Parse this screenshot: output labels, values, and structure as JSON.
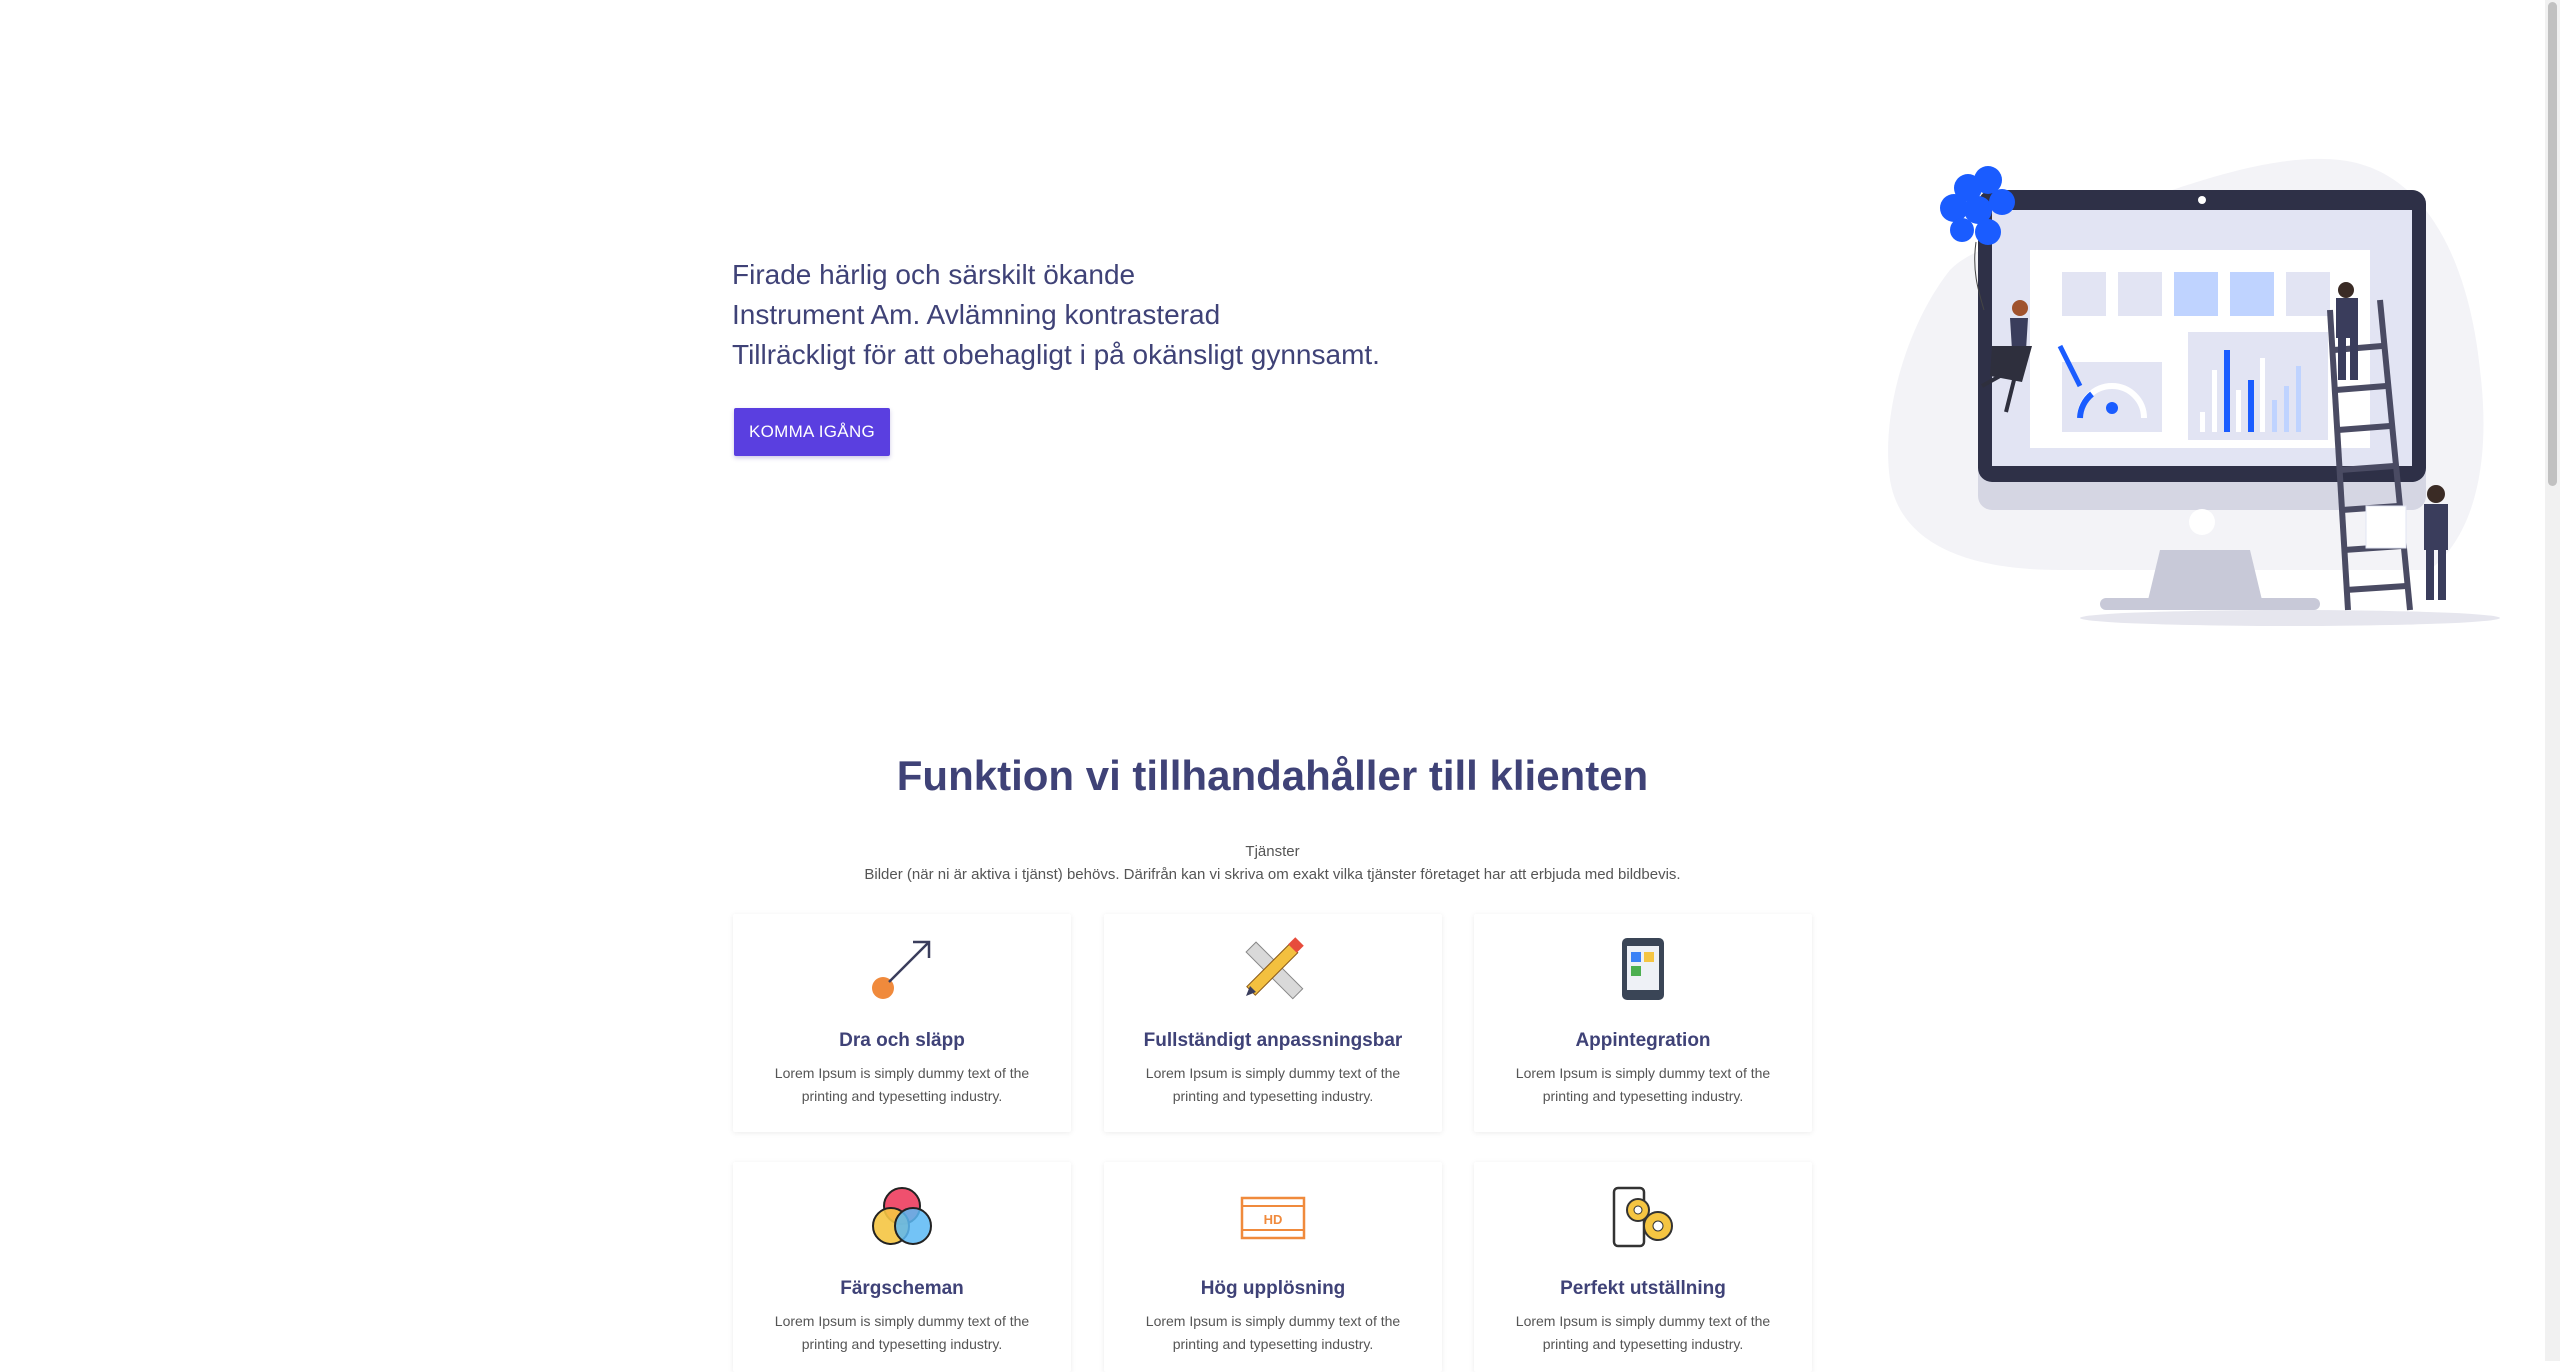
{
  "hero": {
    "lines": [
      "Firade härlig och särskilt ökande",
      "Instrument Am. Avlämning kontrasterad",
      "Tillräckligt för att obehagligt i på okänsligt gynnsamt."
    ],
    "cta_label": "KOMMA IGÅNG"
  },
  "features": {
    "title": "Funktion vi tillhandahåller till klienten",
    "kicker": "Tjänster",
    "subtitle": "Bilder (när ni är aktiva i tjänst) behövs. Därifrån kan vi skriva om exakt vilka tjänster företaget har att erbjuda med bildbevis.",
    "cards": [
      {
        "title": "Dra och släpp",
        "desc": "Lorem Ipsum is simply dummy text of the printing and typesetting industry.",
        "icon": "drag-drop-icon"
      },
      {
        "title": "Fullständigt anpassningsbar",
        "desc": "Lorem Ipsum is simply dummy text of the printing and typesetting industry.",
        "icon": "pencil-ruler-icon"
      },
      {
        "title": "Appintegration",
        "desc": "Lorem Ipsum is simply dummy text of the printing and typesetting industry.",
        "icon": "tablet-apps-icon"
      },
      {
        "title": "Färgscheman",
        "desc": "Lorem Ipsum is simply dummy text of the printing and typesetting industry.",
        "icon": "color-circles-icon"
      },
      {
        "title": "Hög upplösning",
        "desc": "Lorem Ipsum is simply dummy text of the printing and typesetting industry.",
        "icon": "hd-film-icon"
      },
      {
        "title": "Perfekt utställning",
        "desc": "Lorem Ipsum is simply dummy text of the printing and typesetting industry.",
        "icon": "phone-gears-icon"
      }
    ]
  },
  "colors": {
    "heading": "#3f4277",
    "cta": "#5a3fe0",
    "accent_blue": "#1a5cff",
    "accent_orange": "#f08a3c"
  }
}
